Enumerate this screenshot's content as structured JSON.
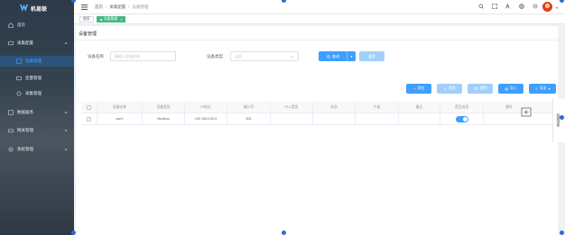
{
  "brand": {
    "name": "机易联"
  },
  "sidebar": {
    "items": [
      {
        "label": "首页",
        "icon": "home-icon"
      },
      {
        "label": "采集配置",
        "icon": "config-icon",
        "expanded": true
      },
      {
        "label": "设备管理",
        "icon": "device-icon",
        "active": true
      },
      {
        "label": "变量管理",
        "icon": "variable-icon"
      },
      {
        "label": "采集管理",
        "icon": "collect-icon"
      },
      {
        "label": "数据服务",
        "icon": "data-service-icon"
      },
      {
        "label": "网关管理",
        "icon": "gateway-icon"
      },
      {
        "label": "系统管理",
        "icon": "system-icon"
      }
    ]
  },
  "header": {
    "breadcrumb": [
      "首页",
      "采集配置",
      "设备管理"
    ]
  },
  "tags": {
    "home": "首页",
    "active": "设备管理"
  },
  "page": {
    "title": "设备管理"
  },
  "search": {
    "device_name_label": "设备名称",
    "device_name_placeholder": "请输入设备名称",
    "device_type_label": "设备类型",
    "device_type_value": "全部",
    "query_label": "查询",
    "reset_label": "重置"
  },
  "toolbar": {
    "add": "添加",
    "edit": "修改",
    "delete": "删除",
    "import": "导入",
    "export": "导出"
  },
  "table": {
    "headers": [
      "",
      "设备名称",
      "设备类型",
      "IP地址",
      "端口号",
      "PLC类型",
      "状态",
      "产量",
      "备注",
      "是否启用",
      "操作"
    ],
    "rows": [
      {
        "name": "ose1",
        "type": "Modbus",
        "ip": "192.168.100.5",
        "port": "502",
        "plc": "",
        "status": "",
        "output": "",
        "remark": "",
        "enabled": true
      }
    ]
  },
  "side_panel": {
    "label": "隐藏搜索"
  },
  "colors": {
    "primary": "#409eff",
    "tag_active": "#42b983",
    "sidebar": "#2c3a4a"
  }
}
